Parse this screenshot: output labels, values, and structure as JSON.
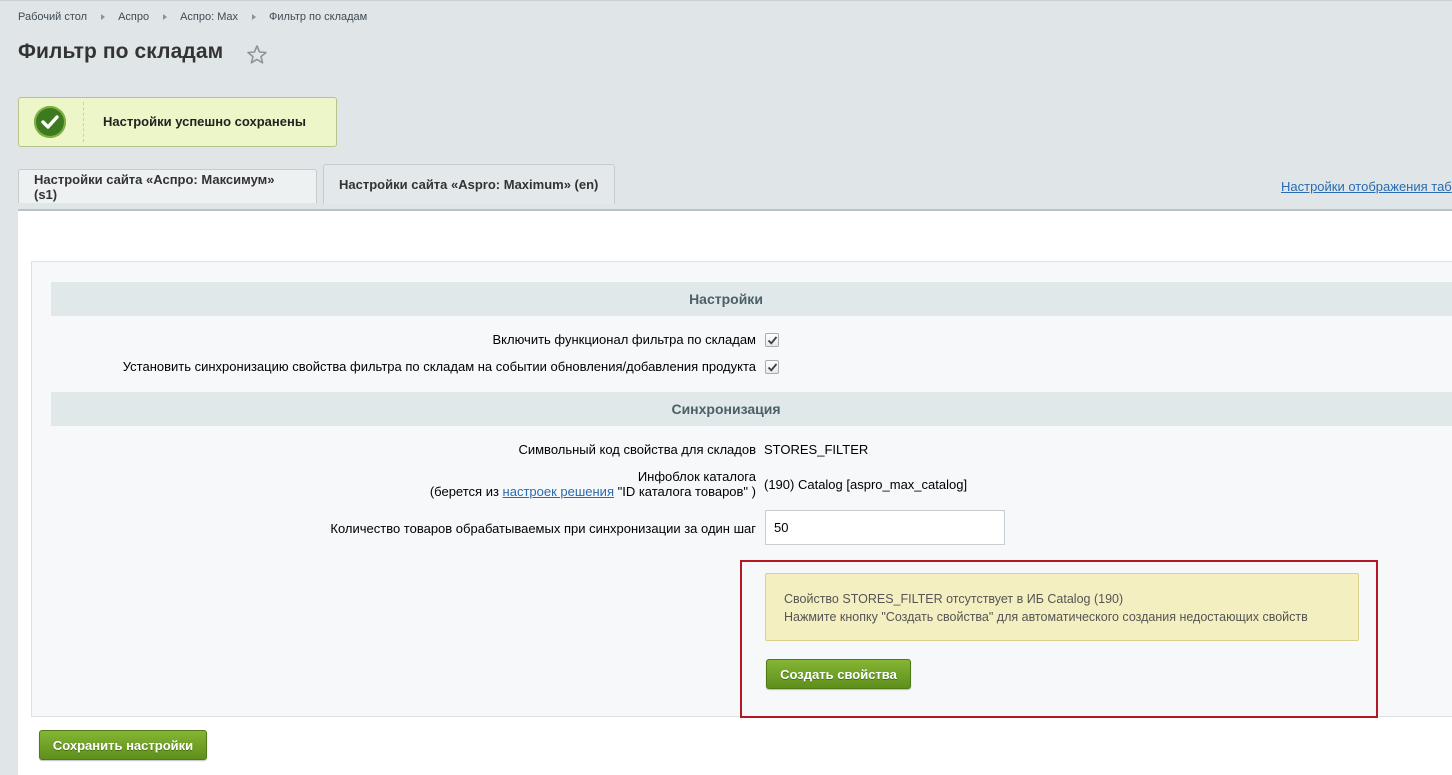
{
  "breadcrumbs": [
    "Рабочий стол",
    "Аспро",
    "Аспро: Max",
    "Фильтр по складам"
  ],
  "page_title": "Фильтр по складам",
  "success_message": "Настройки успешно сохранены",
  "tabs": [
    {
      "label": "Настройки сайта «Аспро: Максимум» (s1)",
      "active": false
    },
    {
      "label": "Настройки сайта «Aspro: Maximum» (en)",
      "active": true
    }
  ],
  "tab_settings_link": "Настройки отображения таб",
  "sections": {
    "settings": {
      "title": "Настройки",
      "enable_filter_label": "Включить функционал фильтра по складам",
      "enable_filter_checked": true,
      "sync_label": "Установить синхронизацию свойства фильтра по складам на событии обновления/добавления продукта",
      "sync_checked": true
    },
    "sync": {
      "title": "Синхронизация",
      "prop_code_label": "Символьный код свойства для складов",
      "prop_code_value": "STORES_FILTER",
      "iblock_label_line1": "Инфоблок каталога",
      "iblock_label_prefix": "(берется из ",
      "iblock_label_link": "настроек решения",
      "iblock_label_suffix": " \"ID каталога товаров\" )",
      "iblock_value": "(190) Catalog [aspro_max_catalog]",
      "count_label": "Количество товаров обрабатываемых при синхронизации за один шаг",
      "count_value": "50"
    }
  },
  "notice": {
    "line1": "Свойство STORES_FILTER отсутствует в ИБ Catalog (190)",
    "line2": "Нажмите кнопку \"Создать свойства\" для автоматического создания недостающих свойств"
  },
  "create_button": "Создать свойства",
  "save_button": "Сохранить настройки",
  "colors": {
    "accent_green": "#6a9e22",
    "highlight_frame": "#b41822",
    "link": "#2a6bb1"
  }
}
